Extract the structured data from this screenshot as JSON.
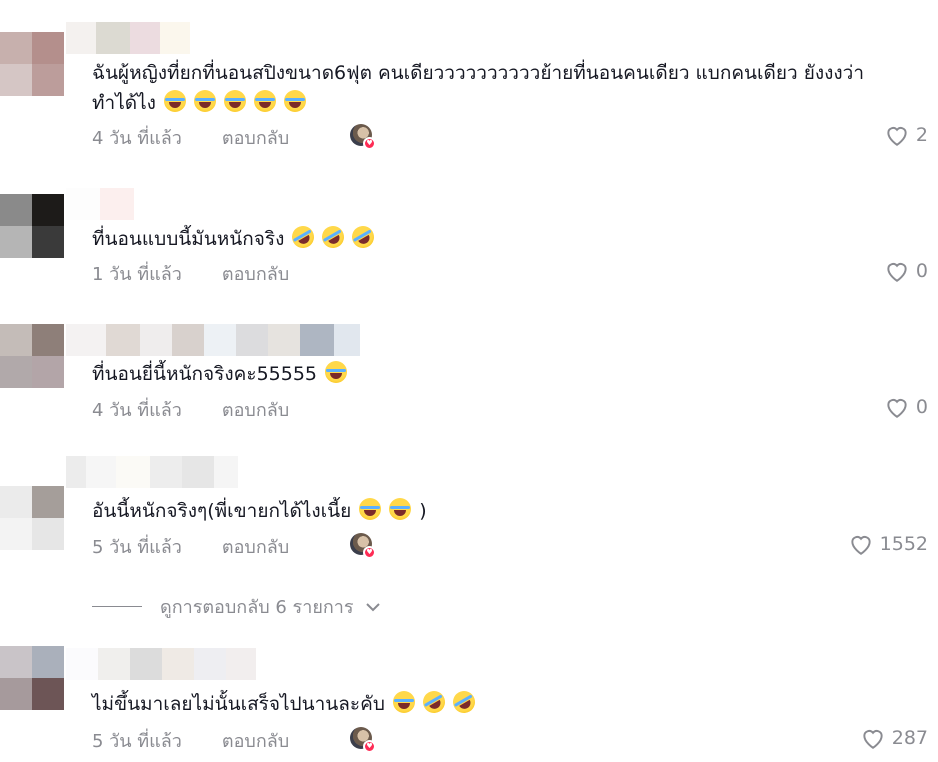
{
  "comments": [
    {
      "text_line1": "ฉันผู้หญิงที่ยกที่นอนสปิงขนาด6ฟุต คนเดียววววววววววย้ายที่นอนคนเดียว แบกคนเดียว ยังงงว่า",
      "text_line2": "ทำได้ไง",
      "emojis": [
        "face-with-tears-of-joy",
        "face-with-tears-of-joy",
        "face-with-tears-of-joy",
        "face-with-tears-of-joy",
        "face-with-tears-of-joy"
      ],
      "time": "4 วัน ที่แล้ว",
      "reply": "ตอบกลับ",
      "creator_liked": true,
      "likes": "2"
    },
    {
      "text_line1": "ที่นอนแบบนี้มันหนักจริง",
      "emojis": [
        "rolling-on-floor-laughing",
        "rolling-on-floor-laughing",
        "rolling-on-floor-laughing"
      ],
      "time": "1 วัน ที่แล้ว",
      "reply": "ตอบกลับ",
      "creator_liked": false,
      "likes": "0"
    },
    {
      "text_line1": "ที่นอนยี่นี้หนักจริงคะ55555",
      "emojis": [
        "face-with-tears-of-joy"
      ],
      "time": "4 วัน ที่แล้ว",
      "reply": "ตอบกลับ",
      "creator_liked": false,
      "likes": "0"
    },
    {
      "text_line1": "อันนี้หนักจริงๆ(พี่เขายกได้ไงเนี้ย",
      "text_suffix": ")",
      "emojis": [
        "face-with-tears-of-joy",
        "face-with-tears-of-joy"
      ],
      "time": "5 วัน ที่แล้ว",
      "reply": "ตอบกลับ",
      "creator_liked": true,
      "likes": "1552"
    },
    {
      "text_line1": "ไม่ขึ้นมาเลยไม่นั้นเสร็จไปนานละคับ",
      "emojis": [
        "face-with-tears-of-joy",
        "rolling-on-floor-laughing",
        "rolling-on-floor-laughing"
      ],
      "time": "5 วัน ที่แล้ว",
      "reply": "ตอบกลับ",
      "creator_liked": true,
      "likes": "287"
    }
  ],
  "view_replies": {
    "label": "ดูการตอบกลับ 6 รายการ",
    "icon": "chevron-down-icon"
  },
  "colors": {
    "meta_gray": "#8a8b91",
    "text": "#161823",
    "heart_badge": "#fe2c55"
  }
}
